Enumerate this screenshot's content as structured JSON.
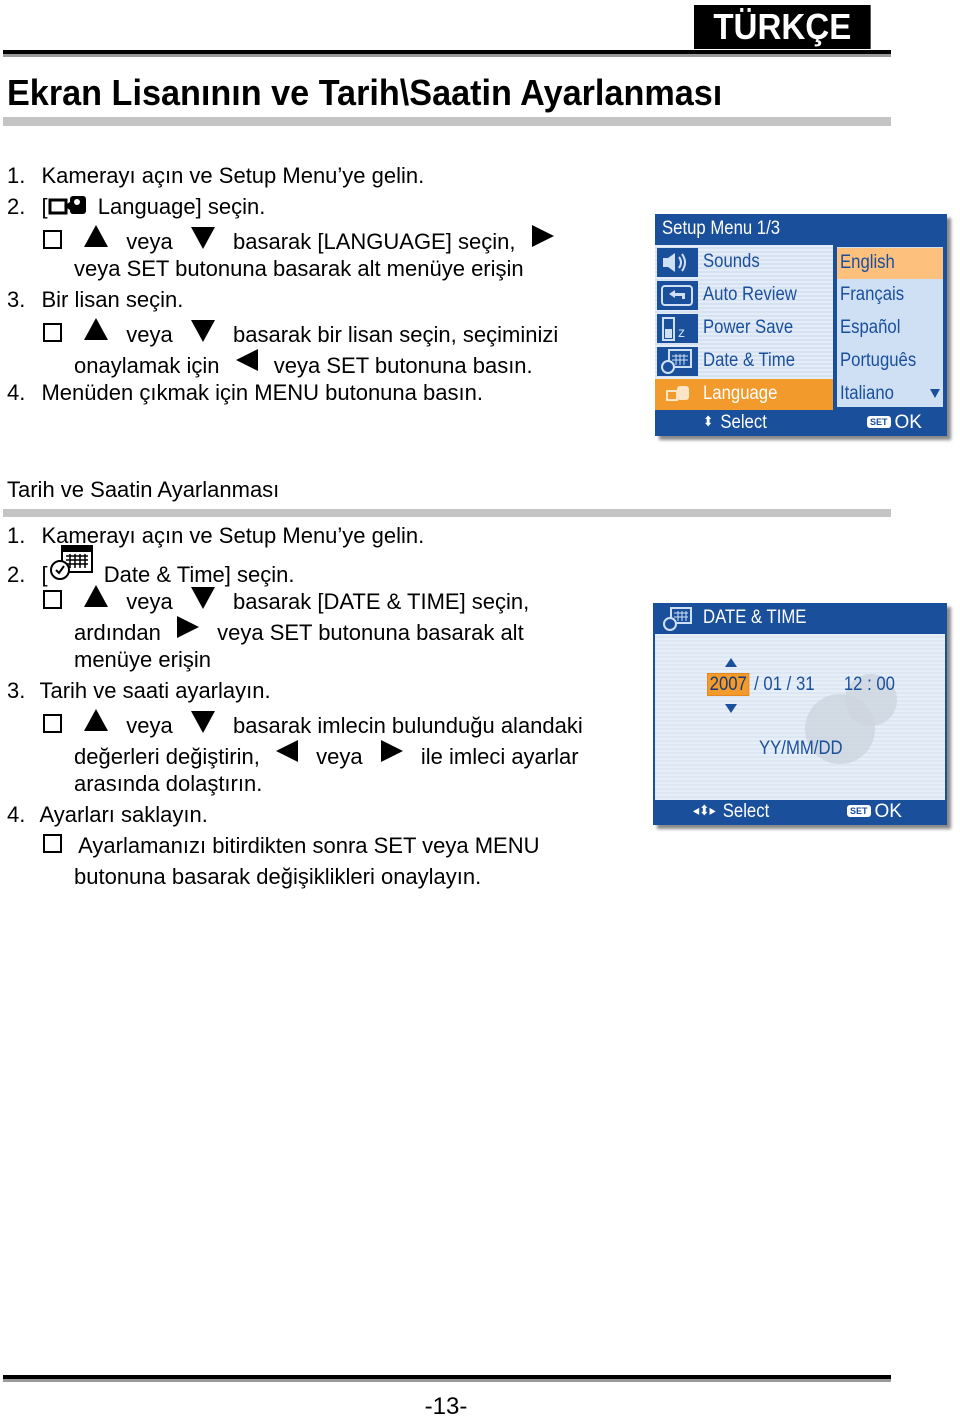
{
  "header": {
    "language_badge": "TÜRKÇE",
    "page_title": "Ekran Lisanının ve Tarih\\Saatin Ayarlanması"
  },
  "section1": {
    "step1": {
      "num": "1.",
      "text": "Kamerayı açın ve Setup Menu’ye gelin."
    },
    "step2": {
      "num": "2.",
      "open": "[",
      "text": "Language] seçin."
    },
    "step2_sub_line1": {
      "or": "veya",
      "text": "basarak [LANGUAGE] seçin,"
    },
    "step2_sub_line2": "veya SET butonuna basarak alt menüye erişin",
    "step3": {
      "num": "3.",
      "text": "Bir lisan seçin."
    },
    "step3_sub_line1": {
      "or": "veya",
      "text": "basarak bir lisan seçin, seçiminizi"
    },
    "step3_sub_line2": {
      "before": "onaylamak için",
      "after": "veya SET butonuna basın."
    },
    "step4": {
      "num": "4.",
      "text": "Menüden çıkmak için MENU butonuna basın."
    }
  },
  "screen1": {
    "title": "Setup Menu 1/3",
    "menu_items": [
      {
        "label": "Sounds",
        "icon": "speaker-icon",
        "selected": false
      },
      {
        "label": "Auto Review",
        "icon": "review-icon",
        "selected": false
      },
      {
        "label": "Power Save",
        "icon": "battery-sleep-icon",
        "selected": false
      },
      {
        "label": "Date & Time",
        "icon": "calendar-clock-icon",
        "selected": false
      },
      {
        "label": "Language",
        "icon": "language-icon",
        "selected": true
      }
    ],
    "languages": [
      {
        "label": "English",
        "selected": true
      },
      {
        "label": "Français",
        "selected": false
      },
      {
        "label": "Español",
        "selected": false
      },
      {
        "label": "Português",
        "selected": false
      },
      {
        "label": "Italiano",
        "selected": false
      }
    ],
    "footer_select": "Select",
    "footer_set": "SET",
    "footer_ok": "OK",
    "colors": {
      "primary": "#1a4f9c",
      "highlight": "#f39a2c",
      "lang_highlight": "#fdc07d"
    }
  },
  "section2": {
    "title": "Tarih ve Saatin Ayarlanması",
    "step1": {
      "num": "1.",
      "text": "Kamerayı açın ve Setup Menu’ye gelin."
    },
    "step2": {
      "num": "2.",
      "open": "[",
      "text": "Date & Time] seçin."
    },
    "step2_sub_line1": {
      "or": "veya",
      "text": "basarak [DATE & TIME] seçin,"
    },
    "step2_sub_line2": {
      "before": "ardından",
      "after": "veya SET butonuna basarak alt"
    },
    "step2_sub_line3": "menüye erişin",
    "step3": {
      "num": "3.",
      "text": "Tarih ve saati ayarlayın."
    },
    "step3_sub_line1": {
      "or": "veya",
      "text": "basarak imlecin bulunduğu alandaki"
    },
    "step3_sub_line2": {
      "before": "değerleri değiştirin,",
      "mid": "veya",
      "after": "ile imleci ayarlar"
    },
    "step3_sub_line3": "arasında dolaştırın.",
    "step4": {
      "num": "4.",
      "text": "Ayarları saklayın."
    },
    "step4_sub_line1": "Ayarlamanızı bitirdikten sonra SET veya MENU",
    "step4_sub_line2": "butonuna basarak değişiklikleri onaylayın."
  },
  "screen2": {
    "title": "DATE & TIME",
    "year": "2007",
    "date_rest": "/ 01 / 31",
    "time": "12 : 00",
    "format": "YY/MM/DD",
    "footer_select": "Select",
    "footer_set": "SET",
    "footer_ok": "OK"
  },
  "footer": {
    "page_number": "-13-"
  }
}
